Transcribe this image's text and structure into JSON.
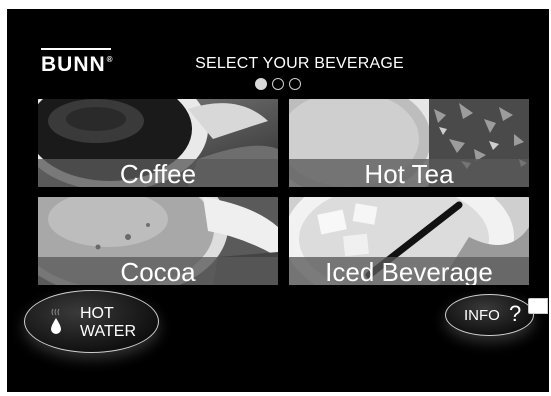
{
  "brand": {
    "logo_text": "BUNN",
    "registered_mark": "®"
  },
  "header": {
    "title": "SELECT YOUR BEVERAGE"
  },
  "pager": {
    "page_count": 3,
    "active_page": 1
  },
  "beverages": [
    {
      "label": "Coffee"
    },
    {
      "label": "Hot Tea"
    },
    {
      "label": "Cocoa"
    },
    {
      "label": "Iced Beverage"
    }
  ],
  "hot_water_button": {
    "line1": "HOT",
    "line2": "WATER",
    "icon": "water-drop-icon"
  },
  "info_button": {
    "label": "INFO",
    "symbol": "?"
  },
  "colors": {
    "background": "#000000",
    "text": "#ffffff",
    "label_band": "#5a5a5a",
    "outline": "#d0d0d0"
  }
}
